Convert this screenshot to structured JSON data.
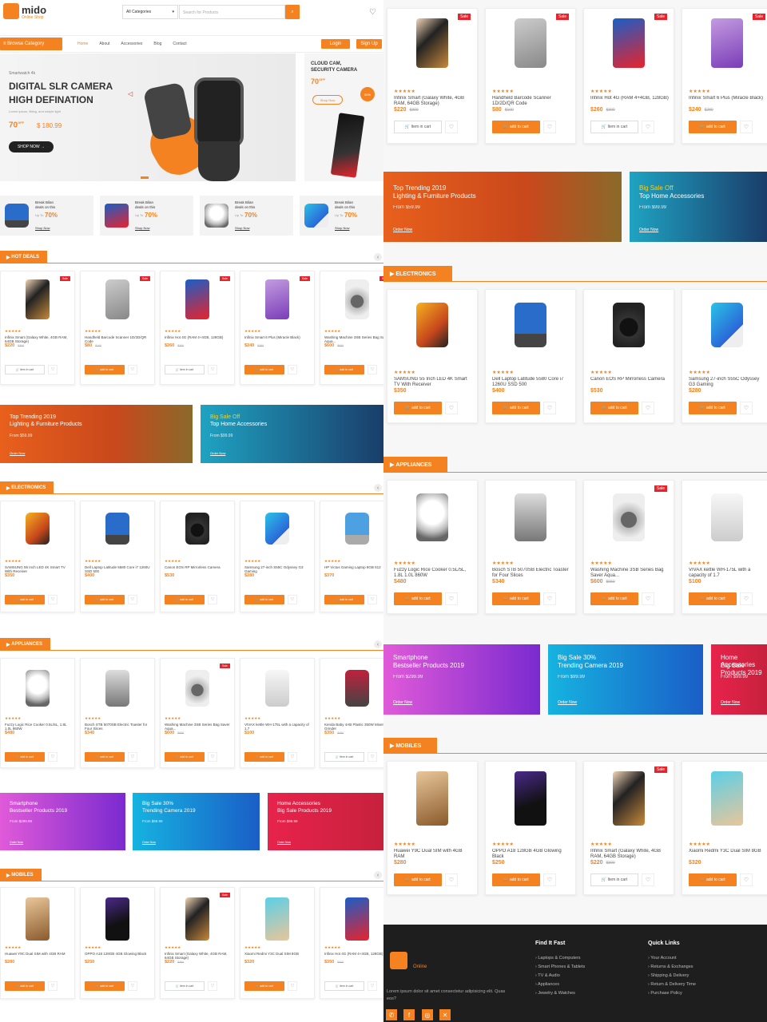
{
  "header": {
    "logo": "mido",
    "logo_sub": "Online Shop",
    "category_select": "All Categories",
    "search_placeholder": "Search for Products"
  },
  "nav": {
    "browse": "Browse Category",
    "items": [
      "Home",
      "About",
      "Accessories",
      "Blog",
      "Contact"
    ],
    "login": "Login",
    "signup": "Sign Up"
  },
  "hero": {
    "kicker": "Smartwatch 4k",
    "title1": "DIGITAL SLR CAMERA",
    "title2": "HIGH DEFINATION",
    "desc": "Lorem ipsum, fitting, and simple light",
    "off": "70",
    "off_suffix": "OFF",
    "price": "$ 180.99",
    "shop": "SHOP NOW"
  },
  "side_promo": {
    "title1": "CLOUD CAM,",
    "title2": "SECURITY CAMERA",
    "off": "70",
    "off_suffix": "OFF",
    "btn": "Shop Now",
    "badge": "50%"
  },
  "mini_promos": [
    {
      "l1": "Break Bilan",
      "l2": "deals on this",
      "up": "Up To",
      "pct": "70%",
      "shop": "Shop Now"
    },
    {
      "l1": "Break Bilan",
      "l2": "deals on this",
      "up": "Up To",
      "pct": "70%",
      "shop": "Shop Now"
    },
    {
      "l1": "Break Bilan",
      "l2": "deals on this",
      "up": "Up To",
      "pct": "70%",
      "shop": "Shop Now"
    },
    {
      "l1": "Break Bilan",
      "l2": "deals on this",
      "up": "Up To",
      "pct": "70%",
      "shop": "Shop Now"
    }
  ],
  "labels": {
    "add_to_cart": "add to cart",
    "item_in_cart": "Item in cart",
    "sale": "Sale",
    "stars": "★★★★★"
  },
  "sections": {
    "hot": "HOT DEALS",
    "electronics": "ELECTRONICS",
    "appliances": "APPLIANCES",
    "mobiles": "MOBILES"
  },
  "hot_deals": [
    {
      "title": "Infinix Smart (Galaxy White, 4GB RAM, 64GB Storage)",
      "price": "$220",
      "old": "$300",
      "sale": true,
      "incart": true,
      "img": "iphone"
    },
    {
      "title": "Handheld Barcode Scanner 1D/2D/QR Code",
      "price": "$80",
      "old": "$100",
      "sale": true,
      "incart": false,
      "img": "scanner"
    },
    {
      "title": "Infinix Hot 4G (RAM 4+4GB, 128GB)",
      "price": "$260",
      "old": "$300",
      "sale": true,
      "incart": true,
      "img": "bluephone"
    },
    {
      "title": "Infinix Smart 6 Plus (Miracle Black)",
      "price": "$240",
      "old": "$280",
      "sale": true,
      "incart": false,
      "img": "purplephone"
    },
    {
      "title": "Washing Machine 3SB Series Bag Saver Aqua...",
      "price": "$600",
      "old": "$650",
      "sale": true,
      "incart": false,
      "img": "washer"
    }
  ],
  "banners1": [
    {
      "t1": "Top Trending 2019",
      "t2": "Lighting & Furniture Products",
      "t3": "From $59.99",
      "cta": "Order Now"
    },
    {
      "t1": "Big Sale Off",
      "t2": "Top Home Accessories",
      "t3": "From $99.99",
      "cta": "Order Now"
    }
  ],
  "electronics": [
    {
      "title": "SAMSUNG 55 Inch LED 4K Smart TV With Receiver",
      "price": "$350",
      "img": "tv"
    },
    {
      "title": "Dell Laptop Latitude 5580 Core i7 1260U SSD 500",
      "price": "$400",
      "img": "laptop"
    },
    {
      "title": "Canon EOS RP Mirrorless Camera",
      "price": "$530",
      "img": "camera"
    },
    {
      "title": "Samsung 27-inch S55C Odyssey G3 Gaming",
      "price": "$280",
      "img": "monitor"
    },
    {
      "title": "HP Victus Gaming Laptop 8GB 512",
      "price": "$370",
      "img": "laptop2"
    }
  ],
  "appliances": [
    {
      "title": "Fuzzy Logic Rice Cooker 0.5L/5L, 1.8L 1.0L 860W",
      "price": "$480",
      "sale": false,
      "incart": false,
      "img": "rice"
    },
    {
      "title": "Bosch STB 5070SB Electric Toaster for Four Slices",
      "price": "$340",
      "sale": false,
      "incart": false,
      "img": "toaster"
    },
    {
      "title": "Washing Machine 3SB Series Bag Saver Aqua...",
      "price": "$600",
      "old": "$650",
      "sale": true,
      "incart": false,
      "img": "washer"
    },
    {
      "title": "VIVAX kettle WH-175L with a capacity of 1.7",
      "price": "$100",
      "sale": false,
      "incart": false,
      "img": "kettle"
    },
    {
      "title": "Kenda Baby 4AB Plastic 350W Mixer Grinder",
      "price": "$350",
      "old": "$400",
      "sale": false,
      "incart": true,
      "img": "mixer"
    }
  ],
  "banners2": [
    {
      "t1": "Smartphone",
      "t2": "Bestseller Products 2019",
      "t3": "From $299.99",
      "cta": "Order Now"
    },
    {
      "t1": "Big Sale 30%",
      "t2": "Trending Camera 2019",
      "t3": "From $99.99",
      "cta": "Order Now"
    },
    {
      "t1": "Home Accessories",
      "t2": "Big Sale Products 2019",
      "t3": "From $99.99",
      "cta": "Order Now"
    }
  ],
  "mobiles": [
    {
      "title": "Huawei Y9C Dual SIM with 4GB RAM",
      "price": "$280",
      "sale": false,
      "incart": false,
      "img": "goldphone"
    },
    {
      "title": "OPPO A18 128GB 4GB Glowing Black",
      "price": "$250",
      "sale": false,
      "incart": false,
      "img": "blackphone"
    },
    {
      "title": "Infinix Smart (Galaxy White, 4GB RAM, 64GB Storage)",
      "price": "$220",
      "old": "$300",
      "sale": true,
      "incart": true,
      "img": "iphone"
    },
    {
      "title": "Xiaomi Redmi Y3C Dual SIM 8GB",
      "price": "$320",
      "sale": false,
      "incart": false,
      "img": "tealphone"
    },
    {
      "title": "Infinix Hot 4G (RAM 4+4GB, 128GB)",
      "price": "$350",
      "old": "$400",
      "sale": false,
      "incart": true,
      "img": "bluephone"
    }
  ],
  "footer": {
    "logo_sub": "Online",
    "about": "Lorem ipsum dolor sit amet consectetur adipisicing elit. Quas eos?",
    "find_title": "Find It Fast",
    "find": [
      "Laptops & Computers",
      "Smart Phones & Tablets",
      "TV & Audio",
      "Appliances",
      "Jewelry & Watches"
    ],
    "quick_title": "Quick Links",
    "quick": [
      "Your Account",
      "Returns & Exchanges",
      "Shipping & Delivery",
      "Return & Delivery Time",
      "Purchase Policy"
    ]
  },
  "colors": {
    "accent": "#f58220",
    "sale": "#e8232c",
    "footer": "#1e1e1e"
  }
}
